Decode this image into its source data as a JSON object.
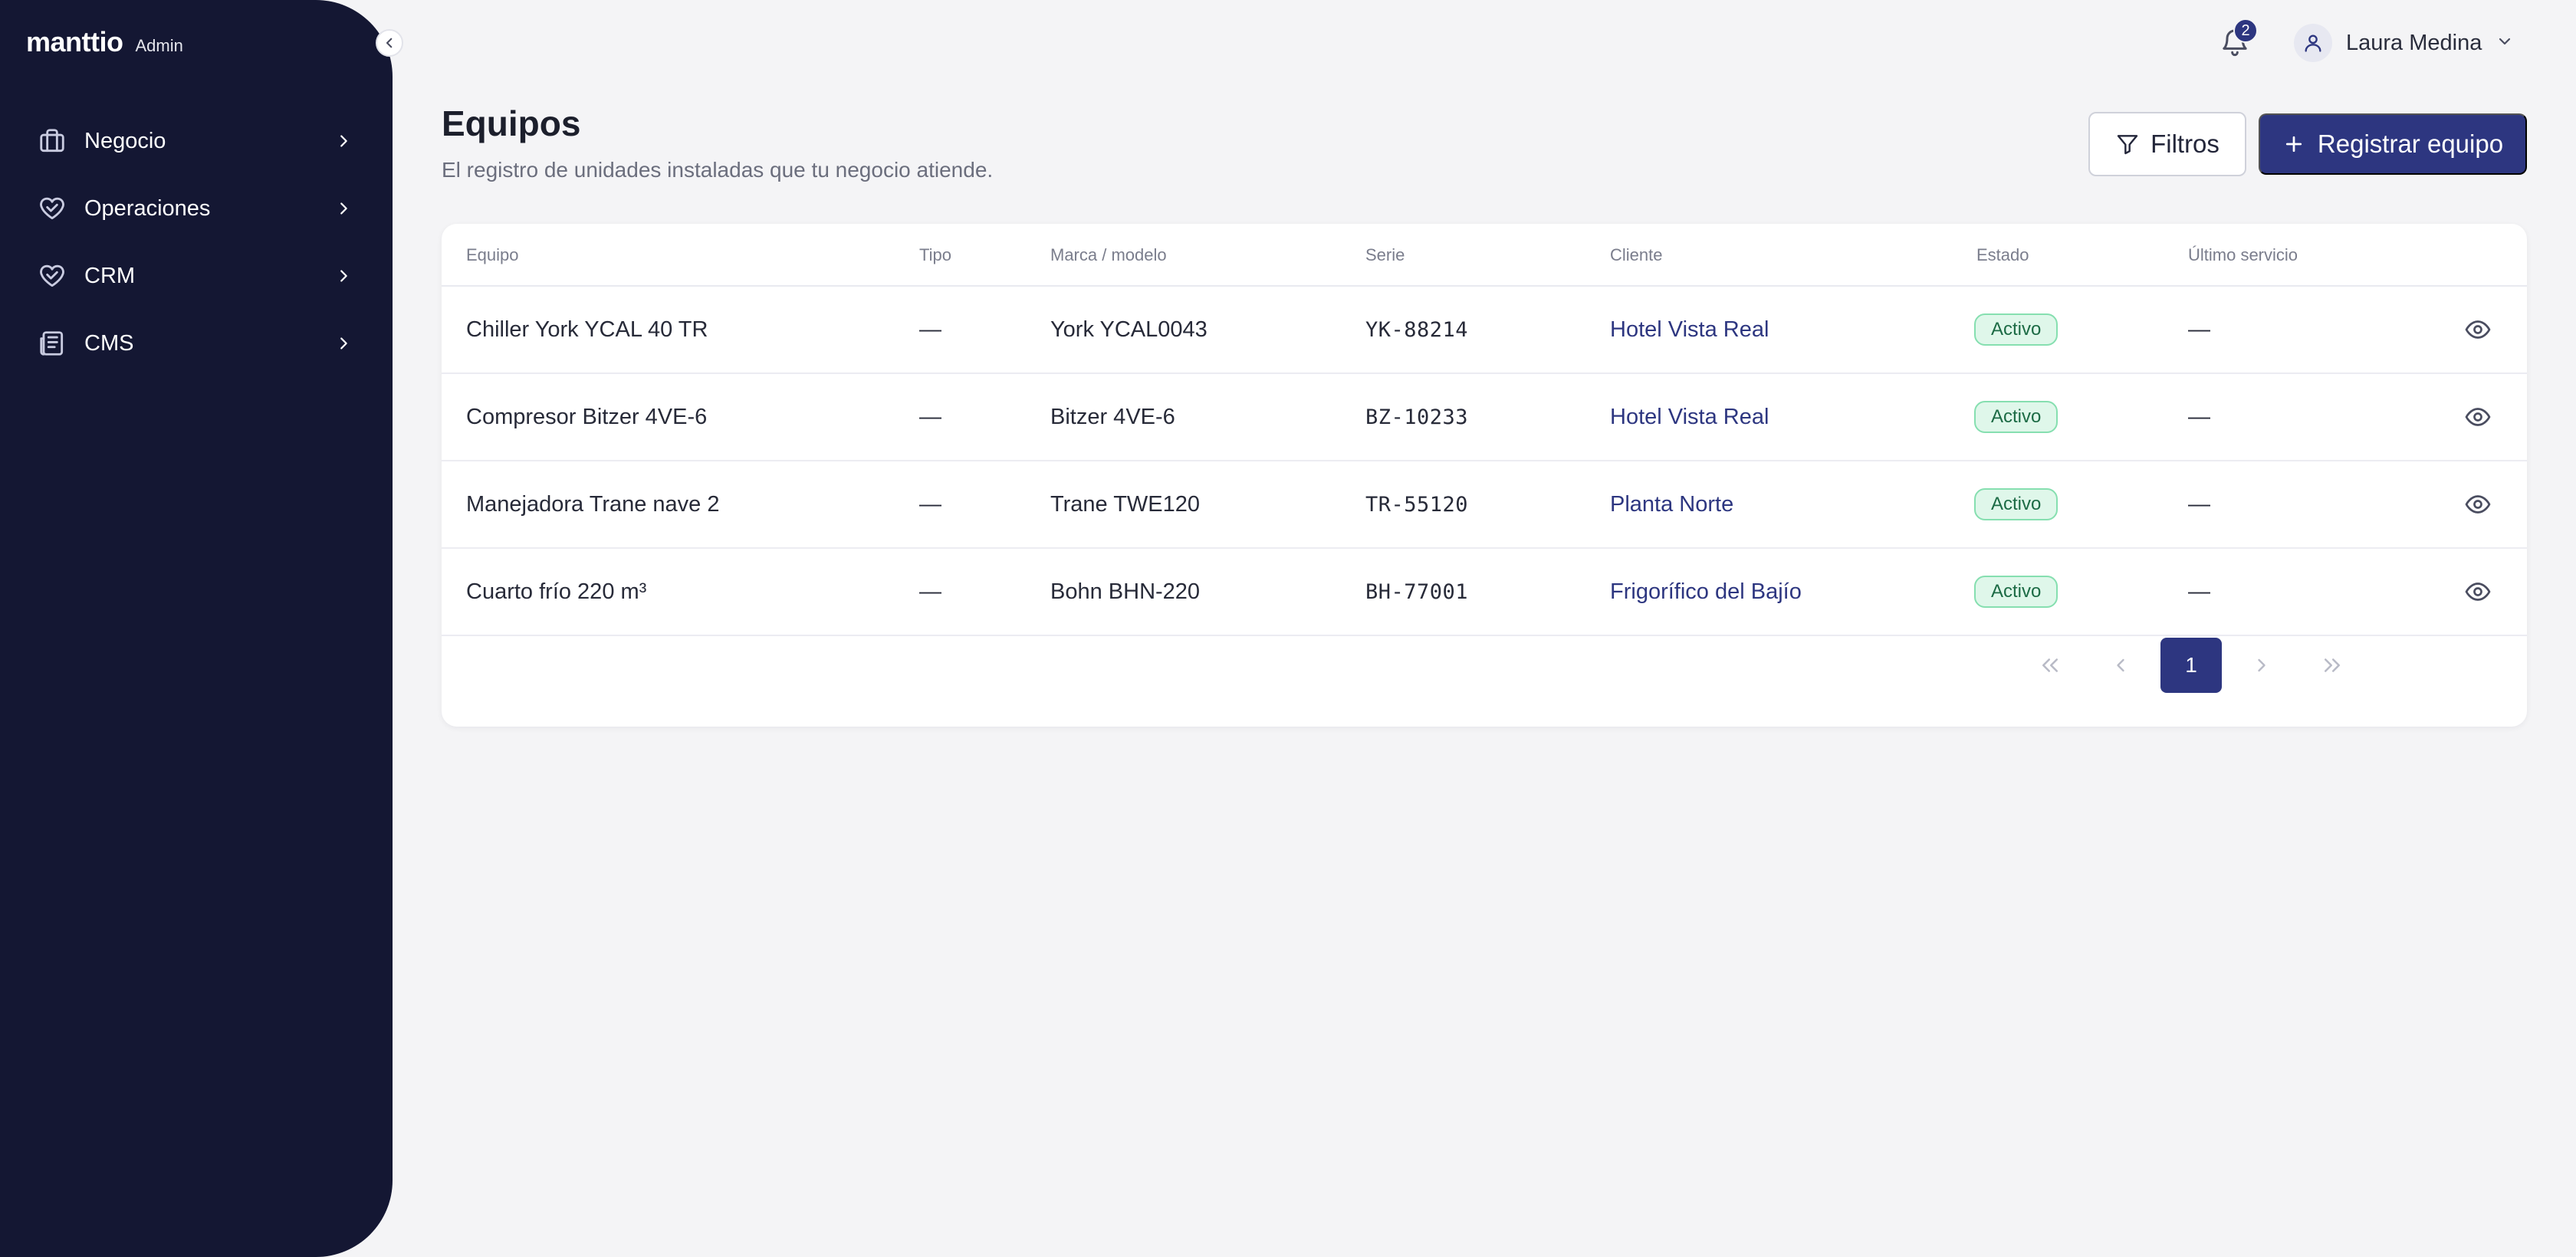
{
  "brand": {
    "logo": "manttio",
    "tag": "Admin"
  },
  "sidebar": {
    "items": [
      {
        "label": "Negocio",
        "icon": "briefcase-icon"
      },
      {
        "label": "Operaciones",
        "icon": "heart-handshake-icon"
      },
      {
        "label": "CRM",
        "icon": "heart-handshake-icon"
      },
      {
        "label": "CMS",
        "icon": "newspaper-icon"
      }
    ]
  },
  "topbar": {
    "notifications_count": "2",
    "user_name": "Laura Medina"
  },
  "page": {
    "title": "Equipos",
    "subtitle": "El registro de unidades instaladas que tu negocio atiende.",
    "filter_label": "Filtros",
    "primary_label": "Registrar equipo"
  },
  "table": {
    "headers": [
      "Equipo",
      "Tipo",
      "Marca / modelo",
      "Serie",
      "Cliente",
      "Estado",
      "Último servicio"
    ],
    "rows": [
      {
        "equipo": "Chiller York YCAL 40 TR",
        "tipo": "—",
        "marca": "York YCAL0043",
        "serie": "YK-88214",
        "cliente": "Hotel Vista Real",
        "estado": "Activo",
        "ultimo": "—"
      },
      {
        "equipo": "Compresor Bitzer 4VE-6",
        "tipo": "—",
        "marca": "Bitzer 4VE-6",
        "serie": "BZ-10233",
        "cliente": "Hotel Vista Real",
        "estado": "Activo",
        "ultimo": "—"
      },
      {
        "equipo": "Manejadora Trane nave 2",
        "tipo": "—",
        "marca": "Trane TWE120",
        "serie": "TR-55120",
        "cliente": "Planta Norte",
        "estado": "Activo",
        "ultimo": "—"
      },
      {
        "equipo": "Cuarto frío 220 m³",
        "tipo": "—",
        "marca": "Bohn BHN-220",
        "serie": "BH-77001",
        "cliente": "Frigorífico del Bajío",
        "estado": "Activo",
        "ultimo": "—"
      }
    ]
  },
  "pagination": {
    "current_page": "1"
  },
  "colors": {
    "sidebar_bg": "#141733",
    "accent": "#2d3680",
    "badge_bg": "#dff7ea",
    "badge_border": "#86dfb0"
  }
}
